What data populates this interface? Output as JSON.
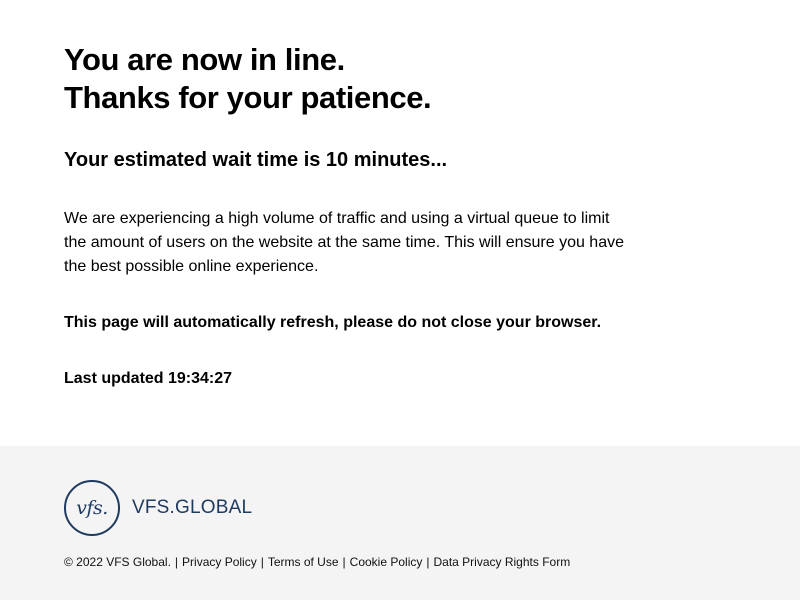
{
  "main": {
    "headline_line1": "You are now in line.",
    "headline_line2": "Thanks for your patience.",
    "wait_time": "Your estimated wait time is 10 minutes...",
    "description": "We are experiencing a high volume of traffic and using a virtual queue to limit the amount of users on the website at the same time. This will ensure you have the best possible online experience.",
    "refresh_notice": "This page will automatically refresh, please do not close your browser.",
    "last_updated": "Last updated 19:34:27"
  },
  "footer": {
    "logo": {
      "mark_text": "vfs.",
      "wordmark": "VFS.GLOBAL",
      "color": "#1f3a5f"
    },
    "copyright": "© 2022 VFS Global.",
    "links": {
      "privacy_policy": "Privacy Policy",
      "terms_of_use": "Terms of Use",
      "cookie_policy": "Cookie Policy",
      "data_privacy_rights_form": "Data Privacy Rights Form"
    },
    "separator": "|",
    "background": "#f4f4f4"
  }
}
